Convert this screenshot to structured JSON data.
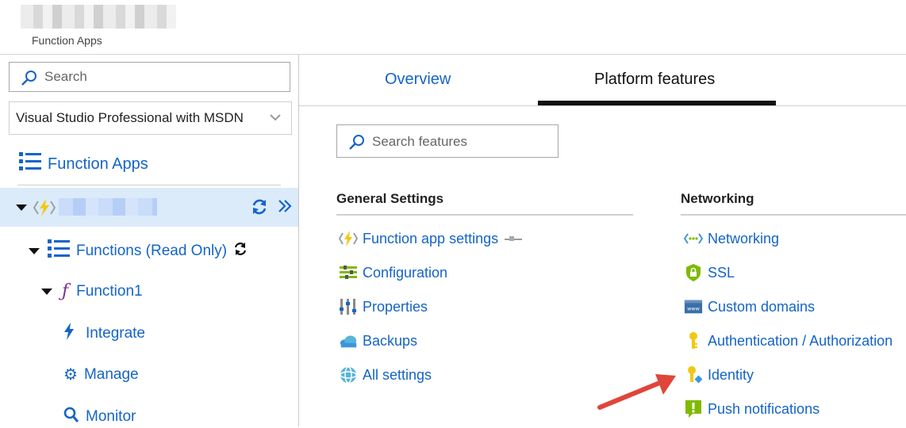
{
  "header": {
    "breadcrumb": "Function Apps"
  },
  "left": {
    "search_placeholder": "Search",
    "subscription": "Visual Studio Professional with MSDN",
    "function_apps_label": "Function Apps",
    "tree": {
      "functions_label": "Functions (Read Only)",
      "function1_label": "Function1",
      "integrate_label": "Integrate",
      "manage_label": "Manage",
      "monitor_label": "Monitor"
    }
  },
  "right": {
    "tabs": {
      "overview": "Overview",
      "platform": "Platform features"
    },
    "search_placeholder": "Search features",
    "general": {
      "heading": "General Settings",
      "items": [
        "Function app settings",
        "Configuration",
        "Properties",
        "Backups",
        "All settings"
      ]
    },
    "networking": {
      "heading": "Networking",
      "items": [
        "Networking",
        "SSL",
        "Custom domains",
        "Authentication / Authorization",
        "Identity",
        "Push notifications"
      ]
    }
  },
  "colors": {
    "link": "#1464c8",
    "selected_row": "#dcebfa",
    "arrow": "#e0453a",
    "function_yellow": "#f2c811"
  }
}
